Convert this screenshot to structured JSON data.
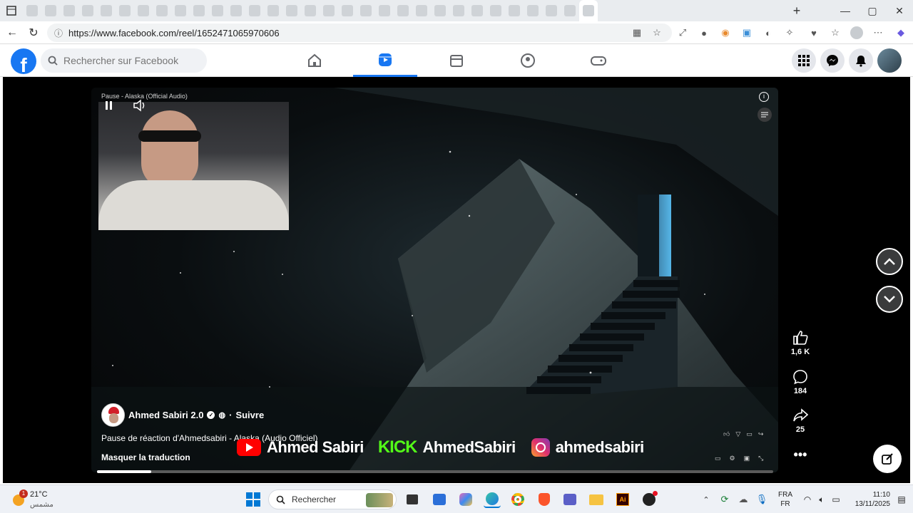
{
  "browser": {
    "url": "https://www.facebook.com/reel/1652471065970606"
  },
  "facebook": {
    "search_placeholder": "Rechercher sur Facebook"
  },
  "reel": {
    "overlay_title": "Pause - Alaska (Official Audio)",
    "author": "Ahmed Sabiri 2.0",
    "follow_label": "Suivre",
    "caption": "Pause de réaction d'Ahmedsabiri - Alaska (Audio Officiel)",
    "translation_toggle": "Masquer la traduction",
    "banner": {
      "youtube_name": "Ahmed Sabiri",
      "kick_label": "KICK",
      "kick_name": "AhmedSabiri",
      "instagram_name": "ahmedsabiri"
    },
    "progress": 0.08,
    "likes": "1,6 K",
    "comments": "184",
    "shares": "25"
  },
  "taskbar": {
    "weather_temp": "21°C",
    "weather_desc": "مشمس",
    "weather_badge": "1",
    "search_label": "Rechercher",
    "lang_top": "FRA",
    "lang_bottom": "FR",
    "time": "11:10",
    "date": "13/11/2025"
  },
  "colors": {
    "fb_blue": "#1877f2",
    "kick_green": "#53fc18",
    "youtube_red": "#ff0000"
  }
}
